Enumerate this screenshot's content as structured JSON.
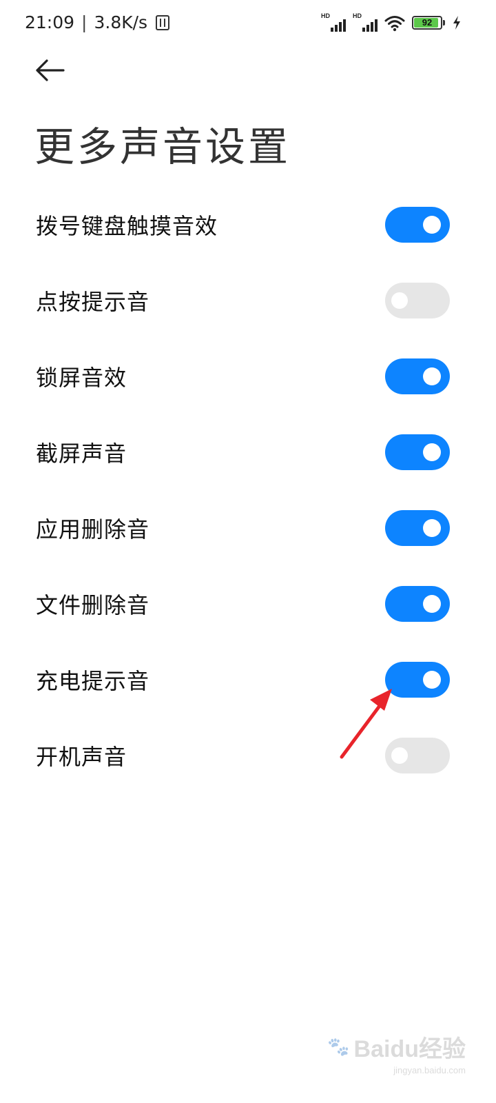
{
  "status_bar": {
    "time": "21:09",
    "separator": "|",
    "network_speed": "3.8K/s",
    "nfc_icon": "nfc-icon",
    "sim1_badge": "HD",
    "sim2_badge": "HD",
    "wifi_icon": "wifi-icon",
    "battery_level": "92",
    "battery_fill_fraction": 0.92,
    "charging_icon": "bolt-icon"
  },
  "header": {
    "back_icon": "arrow-left-icon",
    "title": "更多声音设置"
  },
  "settings": [
    {
      "label": "拨号键盘触摸音效",
      "enabled": true
    },
    {
      "label": "点按提示音",
      "enabled": false
    },
    {
      "label": "锁屏音效",
      "enabled": true
    },
    {
      "label": "截屏声音",
      "enabled": true
    },
    {
      "label": "应用删除音",
      "enabled": true
    },
    {
      "label": "文件删除音",
      "enabled": true
    },
    {
      "label": "充电提示音",
      "enabled": true
    },
    {
      "label": "开机声音",
      "enabled": false
    }
  ],
  "colors": {
    "toggle_on": "#0d84ff",
    "toggle_off": "#e6e6e6",
    "annotation_arrow": "#e8242b"
  },
  "watermark": {
    "logo": "Baidu经验",
    "site": "jingyan.baidu.com"
  }
}
